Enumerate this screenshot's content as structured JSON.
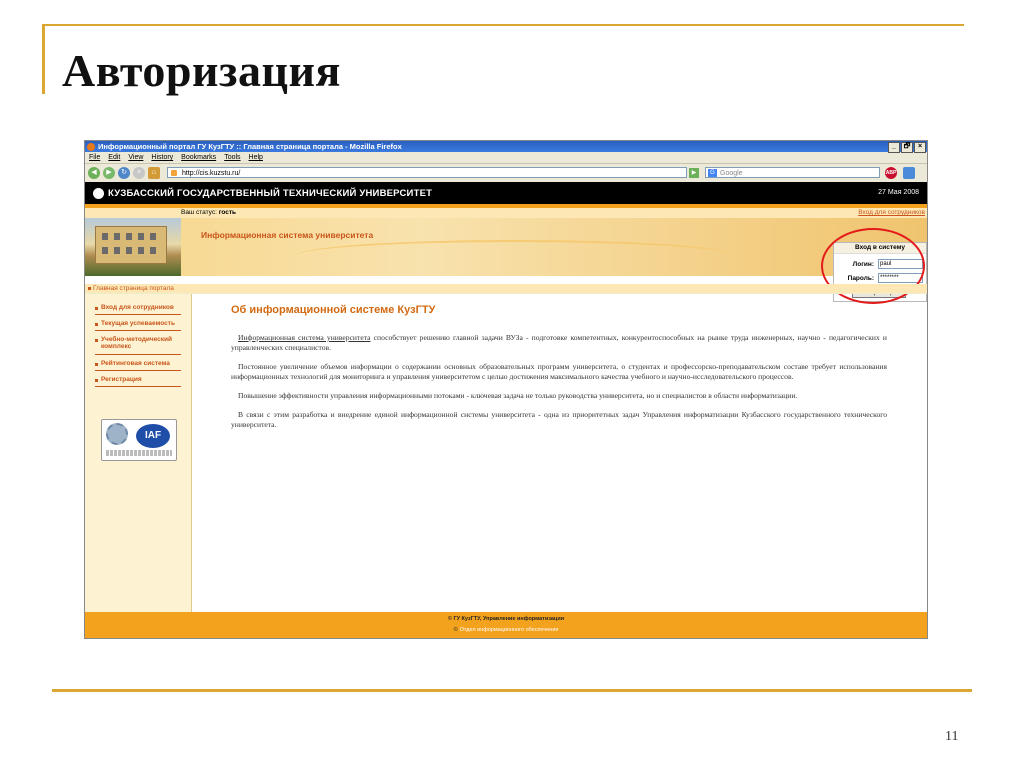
{
  "slide": {
    "title": "Авторизация",
    "page_number": "11"
  },
  "browser": {
    "window_title": "Информационный портал ГУ КузГТУ :: Главная страница портала - Mozilla Firefox",
    "window_buttons": [
      "_",
      "🗗",
      "×"
    ],
    "menu": [
      "File",
      "Edit",
      "View",
      "History",
      "Bookmarks",
      "Tools",
      "Help"
    ],
    "url": "http://cis.kuzstu.ru/",
    "search_placeholder": "Google",
    "search_engine_letter": "G",
    "abp_label": "ABP"
  },
  "page": {
    "university_name": "КУЗБАССКИЙ ГОСУДАРСТВЕННЫЙ ТЕХНИЧЕСКИЙ УНИВЕРСИТЕТ",
    "date": "27 Мая 2008",
    "status_label": "Ваш статус:",
    "status_value": "гость",
    "login_link": "Вход для сотрудников",
    "system_title": "Информационная система университета",
    "breadcrumb": "Главная страница портала",
    "login_box": {
      "title": "Вход в систему",
      "login_label": "Логин:",
      "login_value": "paul",
      "password_label": "Пароль:",
      "password_value": "********",
      "button": "Авторизация"
    },
    "sidebar": [
      "Вход для сотрудников",
      "Текущая успеваемость",
      "Учебно-методический комплекс",
      "Рейтинговая система",
      "Регистрация"
    ],
    "badge_text": "IAF",
    "content": {
      "heading": "Об информационной системе КузГТУ",
      "p1_link": "Информационная система университета",
      "p1_rest": " способствует решению главной задачи ВУЗа - подготовке компетентных, конкурентоспособных на рынке труда инженерных, научно - педагогических и управленческих специалистов.",
      "p2": "Постоянное увеличение объемов информации о содержании основных образовательных программ университета, о студентах и профессорско-преподавательском составе требует использования информационных технологий для мониторинга и управления университетом с целью достижения максимального качества учебного и научно-исследовательского процессов.",
      "p3": "Повышение эффективности управления информационными потоками - ключевая задача не только руководства университета, но и специалистов в области информатизации.",
      "p4": "В связи с этим разработка и внедрение единой информационной системы университета - одна из приоритетных задач Управления информатизации Кузбасского государственного технического университета."
    },
    "footer": {
      "line1": "© ГУ КузГТУ, Управление информатизации",
      "line2_mark": "©",
      "line2": "Отдел информационного обеспечения"
    }
  },
  "colors": {
    "accent_gold": "#d9a732",
    "site_orange": "#f3a21d",
    "link_orange": "#c9551a",
    "highlight_red": "#e41b1b"
  }
}
